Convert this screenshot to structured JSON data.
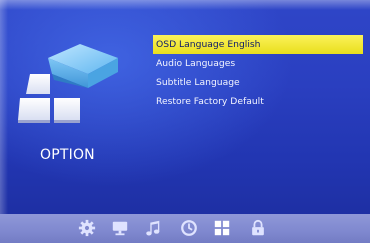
{
  "category": {
    "label": "OPTION",
    "icon": "option-tiles-icon"
  },
  "menu": {
    "items": [
      {
        "label": "OSD Language English",
        "selected": true
      },
      {
        "label": "Audio Languages",
        "selected": false
      },
      {
        "label": "Subtitle Language",
        "selected": false
      },
      {
        "label": "Restore Factory Default",
        "selected": false
      }
    ]
  },
  "footer_tabs": [
    {
      "icon": "gear-icon",
      "active": false
    },
    {
      "icon": "monitor-icon",
      "active": false
    },
    {
      "icon": "music-note-icon",
      "active": false
    },
    {
      "icon": "clock-icon",
      "active": false
    },
    {
      "icon": "option-tiles-icon",
      "active": true
    },
    {
      "icon": "lock-icon",
      "active": false
    }
  ],
  "colors": {
    "background": "#2a3fc0",
    "highlight": "#f4ea30",
    "footer": "#8890d2",
    "text": "#ffffff"
  }
}
